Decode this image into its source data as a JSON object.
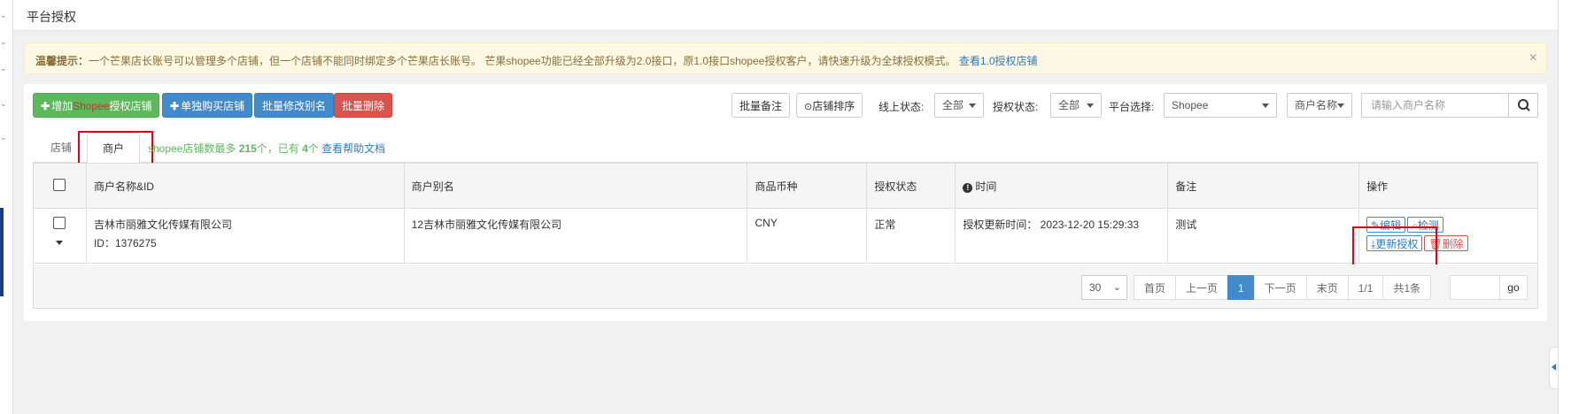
{
  "page": {
    "title": "平台授权"
  },
  "alert": {
    "label": "温馨提示：",
    "message": "一个芒果店长账号可以管理多个店铺，但一个店铺不能同时绑定多个芒果店长账号。 芒果shopee功能已经全部升级为2.0接口，原1.0接口shopee授权客户，请快速升级为全球授权模式。",
    "link": "查看1.0授权店铺",
    "close": "×"
  },
  "toolbar": {
    "add_prefix": "增加",
    "add_platform": "Shopee",
    "add_suffix": "授权店铺",
    "buy_store": "单独购买店铺",
    "batch_alias": "批量修改别名",
    "batch_delete": "批量删除",
    "batch_note": "批量备注",
    "store_sort": "店铺排序",
    "online_status_label": "线上状态:",
    "online_status_value": "全部",
    "auth_status_label": "授权状态:",
    "auth_status_value": "全部",
    "platform_label": "平台选择:",
    "platform_value": "Shopee",
    "search_field_value": "商户名称",
    "search_placeholder": "请输入商户名称"
  },
  "tabs": [
    {
      "label": "店铺",
      "active": false
    },
    {
      "label": "商户",
      "active": true
    }
  ],
  "tab_info": {
    "prefix": "shopee店铺数最多 ",
    "max": "215",
    "mid": "个，已有 ",
    "count": "4",
    "suffix": "个 ",
    "help_link": "查看帮助文档"
  },
  "table": {
    "headers": [
      "商户名称&ID",
      "商户别名",
      "商品币种",
      "授权状态",
      "时间",
      "备注",
      "操作"
    ],
    "rows": [
      {
        "name": "吉林市丽雅文化传媒有限公司",
        "id": "ID：1376275",
        "alias": "12吉林市丽雅文化传媒有限公司",
        "currency": "CNY",
        "status": "正常",
        "time": "授权更新时间： 2023-12-20 15:29:33",
        "note": "测试",
        "actions": {
          "edit": "编辑",
          "check": "检测",
          "renew": "更新授权",
          "delete": "删除"
        }
      }
    ]
  },
  "pagination": {
    "page_size": "30",
    "first": "首页",
    "prev": "上一页",
    "current": "1",
    "next": "下一页",
    "last": "末页",
    "pages": "1/1",
    "total": "共1条",
    "go": "go"
  },
  "colors": {
    "primary": "#428bca",
    "success": "#5cb85c",
    "danger": "#d9534f",
    "highlight": "#e60012",
    "alert_bg": "#fcf8e3"
  }
}
